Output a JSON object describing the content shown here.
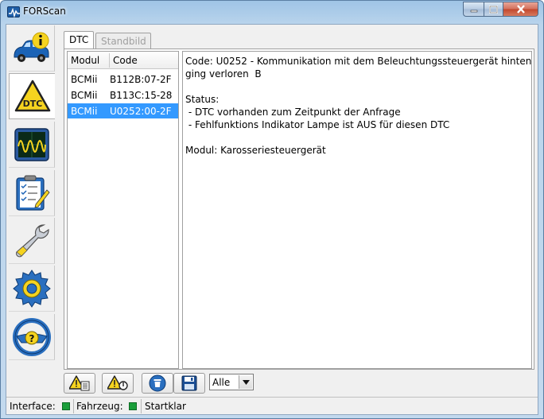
{
  "window": {
    "title": "FORScan"
  },
  "sidebar": {
    "items": [
      {
        "icon": "car-info-icon"
      },
      {
        "icon": "dtc-warning-icon"
      },
      {
        "icon": "oscilloscope-icon"
      },
      {
        "icon": "checklist-icon"
      },
      {
        "icon": "wrench-icon"
      },
      {
        "icon": "gear-icon"
      },
      {
        "icon": "help-steering-wheel-icon"
      }
    ]
  },
  "tabs": [
    {
      "label": "DTC",
      "active": true
    },
    {
      "label": "Standbild",
      "active": false
    }
  ],
  "dtc_list": {
    "headers": {
      "module": "Modul",
      "code": "Code"
    },
    "rows": [
      {
        "module": "BCMii",
        "code": "B112B:07-2F",
        "selected": false
      },
      {
        "module": "BCMii",
        "code": "B113C:15-28",
        "selected": false
      },
      {
        "module": "BCMii",
        "code": "U0252:00-2F",
        "selected": true
      }
    ]
  },
  "details": {
    "line1": "Code: U0252 - Kommunikation mit dem Beleuchtungssteuergerät hinten",
    "line2": "ging verloren  B",
    "line3": "",
    "line4": "Status:",
    "line5": " - DTC vorhanden zum Zeitpunkt der Anfrage",
    "line6": " - Fehlfunktions Indikator Lampe ist AUS für diesen DTC",
    "line7": "",
    "line8": "Modul: Karosseriesteuergerät"
  },
  "toolbar": {
    "filter_value": "Alle"
  },
  "statusbar": {
    "interface_label": "Interface:",
    "vehicle_label": "Fahrzeug:",
    "state_text": "Startklar"
  },
  "colors": {
    "selection": "#3399ff",
    "status_ok": "#1a9e3a"
  }
}
